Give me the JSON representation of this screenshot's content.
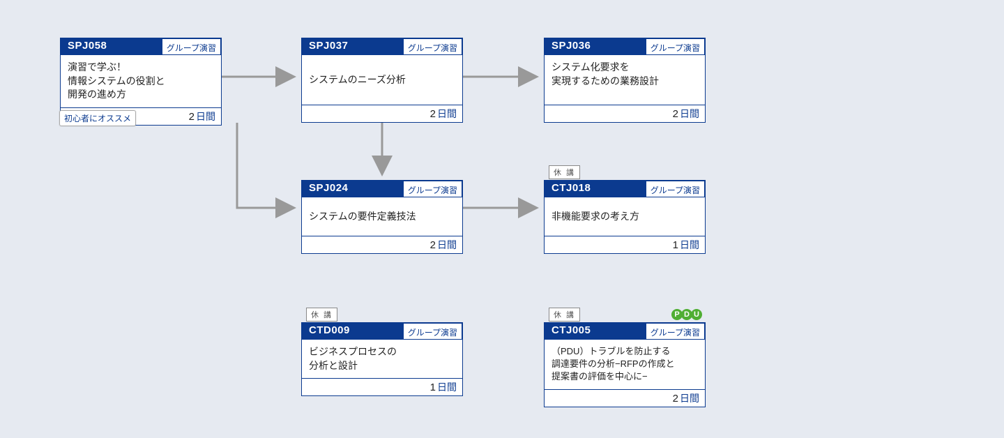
{
  "tags": {
    "group_exercise": "グループ演習",
    "suspended": "休 講",
    "pdu": [
      "P",
      "D",
      "U"
    ],
    "beginner_rec": "初心者にオススメ",
    "days_unit": "日間"
  },
  "cards": {
    "spj058": {
      "code": "SPJ058",
      "title": "演習で学ぶ！\n情報システムの役割と\n開発の進め方",
      "days": "2"
    },
    "spj037": {
      "code": "SPJ037",
      "title": "システムのニーズ分析",
      "days": "2"
    },
    "spj036": {
      "code": "SPJ036",
      "title": "システム化要求を\n実現するための業務設計",
      "days": "2"
    },
    "spj024": {
      "code": "SPJ024",
      "title": "システムの要件定義技法",
      "days": "2"
    },
    "ctj018": {
      "code": "CTJ018",
      "title": "非機能要求の考え方",
      "days": "1"
    },
    "ctd009": {
      "code": "CTD009",
      "title": "ビジネスプロセスの\n分析と設計",
      "days": "1"
    },
    "ctj005": {
      "code": "CTJ005",
      "title": "（PDU）トラブルを防止する\n調達要件の分析−RFPの作成と\n提案書の評価を中心に−",
      "days": "2"
    }
  }
}
